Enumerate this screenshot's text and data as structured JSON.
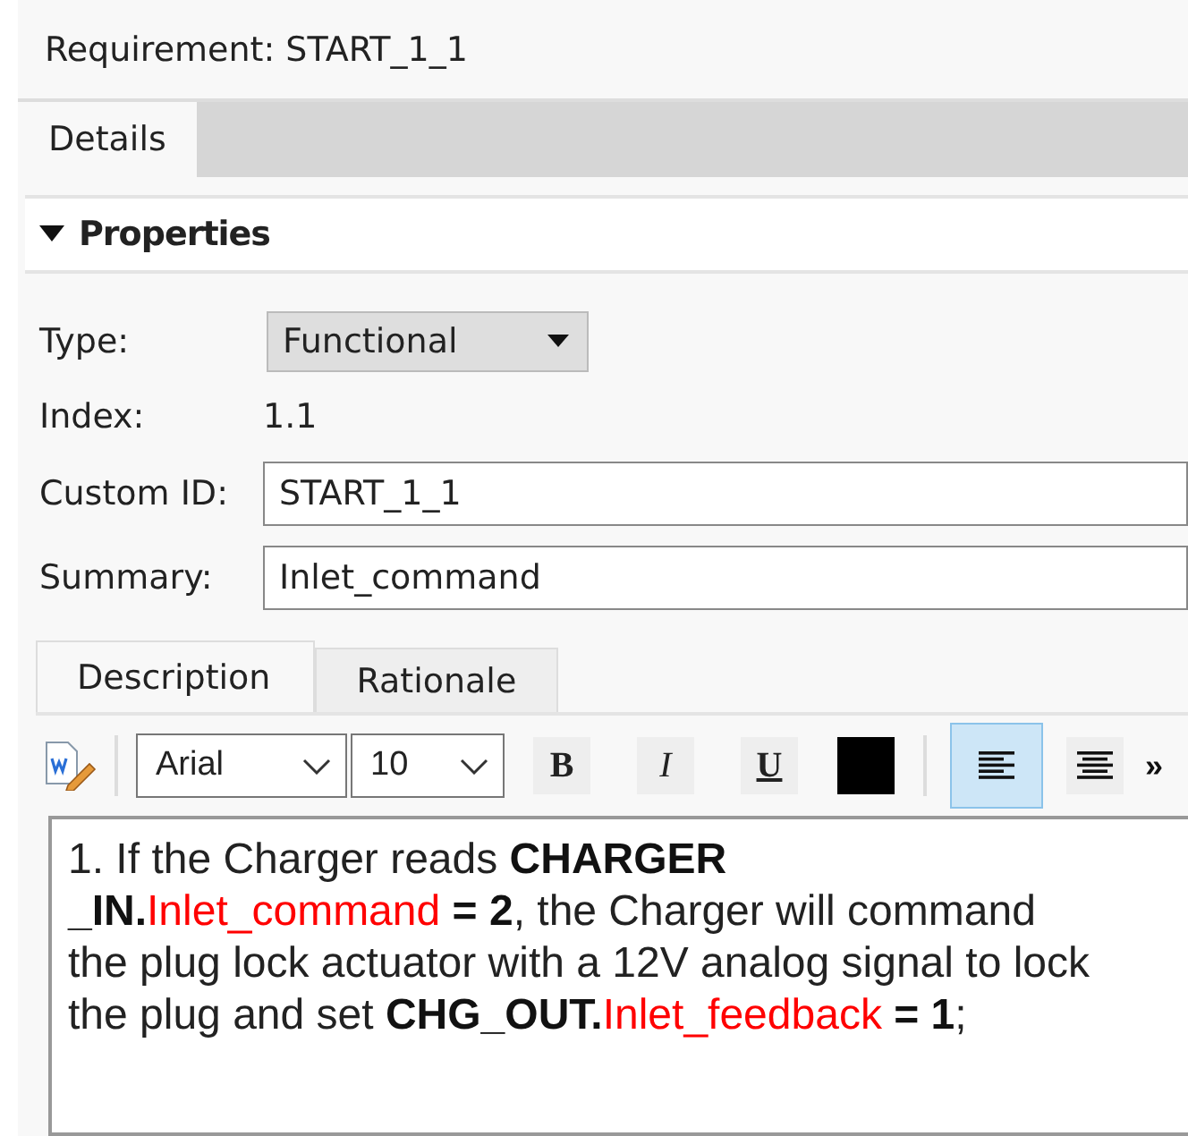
{
  "header": {
    "title": "Requirement: START_1_1"
  },
  "tabs": [
    {
      "label": "Details",
      "selected": true
    }
  ],
  "section": {
    "title": "Properties",
    "expanded": true
  },
  "fields": [
    {
      "kind": "dropdown",
      "label": "Type:",
      "value": "Functional"
    },
    {
      "kind": "text",
      "label": "Index:",
      "value": "1.1"
    },
    {
      "kind": "input",
      "label": "Custom ID:",
      "value": "START_1_1"
    },
    {
      "kind": "input",
      "label": "Summary:",
      "value": "Inlet_command"
    }
  ],
  "editor_tabs": [
    {
      "label": "Description",
      "selected": true
    },
    {
      "label": "Rationale",
      "selected": false
    }
  ],
  "toolbar": {
    "font": "Arial",
    "size": "10",
    "bold_button": "B",
    "italic_button": "I",
    "underline_button": "U",
    "align": [
      {
        "kind": "left",
        "selected": true
      },
      {
        "kind": "center",
        "selected": false
      }
    ],
    "more": "»"
  },
  "description": {
    "lines": [
      [
        {
          "text": "1.  If the Charger reads ",
          "bold": false
        },
        {
          "text": "CHARGER",
          "bold": true
        }
      ],
      [
        {
          "text": "_IN.",
          "bold": true
        },
        {
          "text": "Inlet_command",
          "bold": false,
          "color": "#ff0000"
        },
        {
          "text": " = 2",
          "bold": true
        },
        {
          "text": ", the Charger will command",
          "bold": false
        }
      ],
      [
        {
          "text": "the plug lock actuator with a 12V analog signal to lock",
          "bold": false
        }
      ],
      [
        {
          "text": "the plug and set ",
          "bold": false
        },
        {
          "text": "CHG_OUT.",
          "bold": true
        },
        {
          "text": "Inlet_feedback",
          "bold": false,
          "color": "#ff0000"
        },
        {
          "text": " = 1",
          "bold": true
        },
        {
          "text": ";",
          "bold": false
        }
      ]
    ]
  }
}
